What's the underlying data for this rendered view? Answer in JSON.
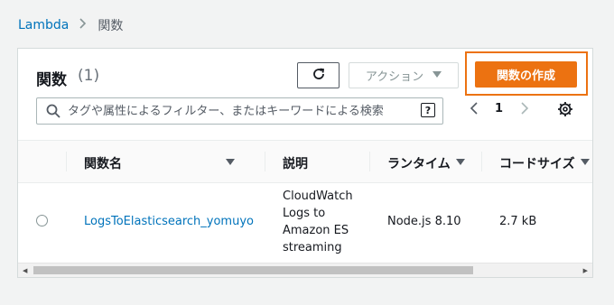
{
  "breadcrumb": {
    "root": "Lambda",
    "current": "関数"
  },
  "panel": {
    "title": "関数",
    "count": "(1)",
    "action_label": "アクション",
    "create_label": "関数の作成"
  },
  "search": {
    "placeholder": "タグや属性によるフィルター、またはキーワードによる検索"
  },
  "pagination": {
    "current_page": "1"
  },
  "table": {
    "columns": [
      "関数名",
      "説明",
      "ランタイム",
      "コードサイズ"
    ],
    "rows": [
      {
        "name": "LogsToElasticsearch_yomuyo",
        "description": "CloudWatch Logs to Amazon ES streaming",
        "runtime": "Node.js 8.10",
        "code_size": "2.7 kB"
      }
    ]
  },
  "colors": {
    "link": "#0073bb",
    "primary": "#ec7211"
  }
}
